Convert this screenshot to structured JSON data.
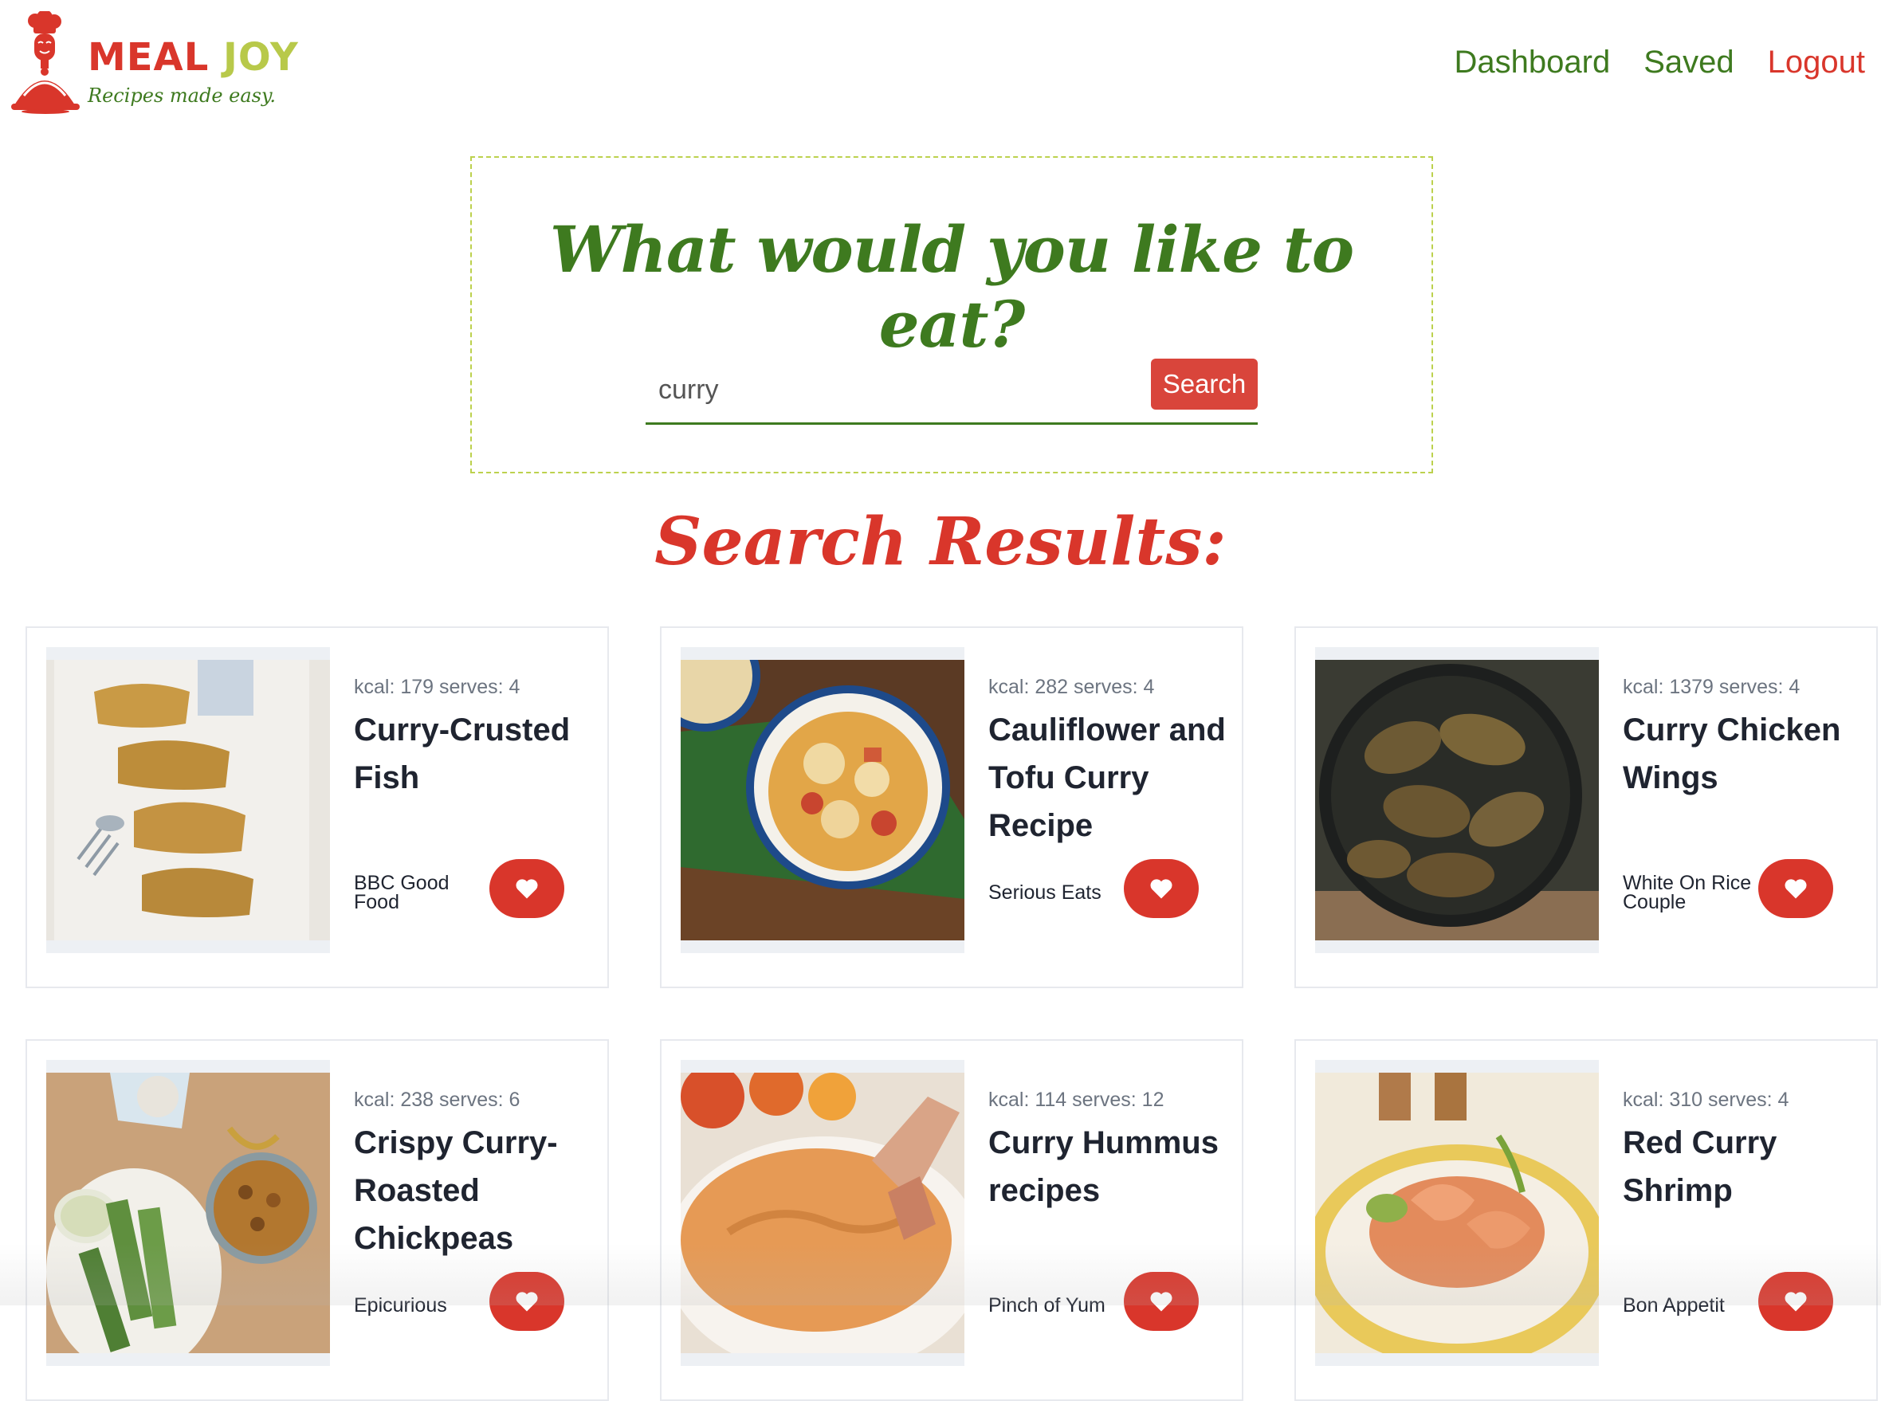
{
  "header": {
    "logo_word_1": "MEAL",
    "logo_word_2": "JOY",
    "logo_tagline": "Recipes made easy.",
    "nav": {
      "dashboard": "Dashboard",
      "saved": "Saved",
      "logout": "Logout"
    }
  },
  "search": {
    "title": "What would you like to eat?",
    "query": "curry",
    "button_label": "Search"
  },
  "results": {
    "title": "Search Results:",
    "cards": [
      {
        "meta": "kcal: 179 serves: 4",
        "title": "Curry-Crusted Fish",
        "source": "BBC Good Food"
      },
      {
        "meta": "kcal: 282 serves: 4",
        "title": "Cauliflower and Tofu Curry Recipe",
        "source": "Serious Eats"
      },
      {
        "meta": "kcal: 1379 serves: 4",
        "title": "Curry Chicken Wings",
        "source": "White On Rice Couple"
      },
      {
        "meta": "kcal: 238 serves: 6",
        "title": "Crispy Curry-Roasted Chickpeas",
        "source": "Epicurious"
      },
      {
        "meta": "kcal: 114 serves: 12",
        "title": "Curry Hummus recipes",
        "source": "Pinch of Yum"
      },
      {
        "meta": "kcal: 310 serves: 4",
        "title": "Red Curry Shrimp",
        "source": "Bon Appetit"
      }
    ]
  },
  "icons": {
    "favorite": "heart-icon",
    "logo": "chef-cloche-icon"
  },
  "colors": {
    "brand_red": "#d9362b",
    "brand_green": "#3e7a1f",
    "brand_lime": "#b8c94a"
  }
}
